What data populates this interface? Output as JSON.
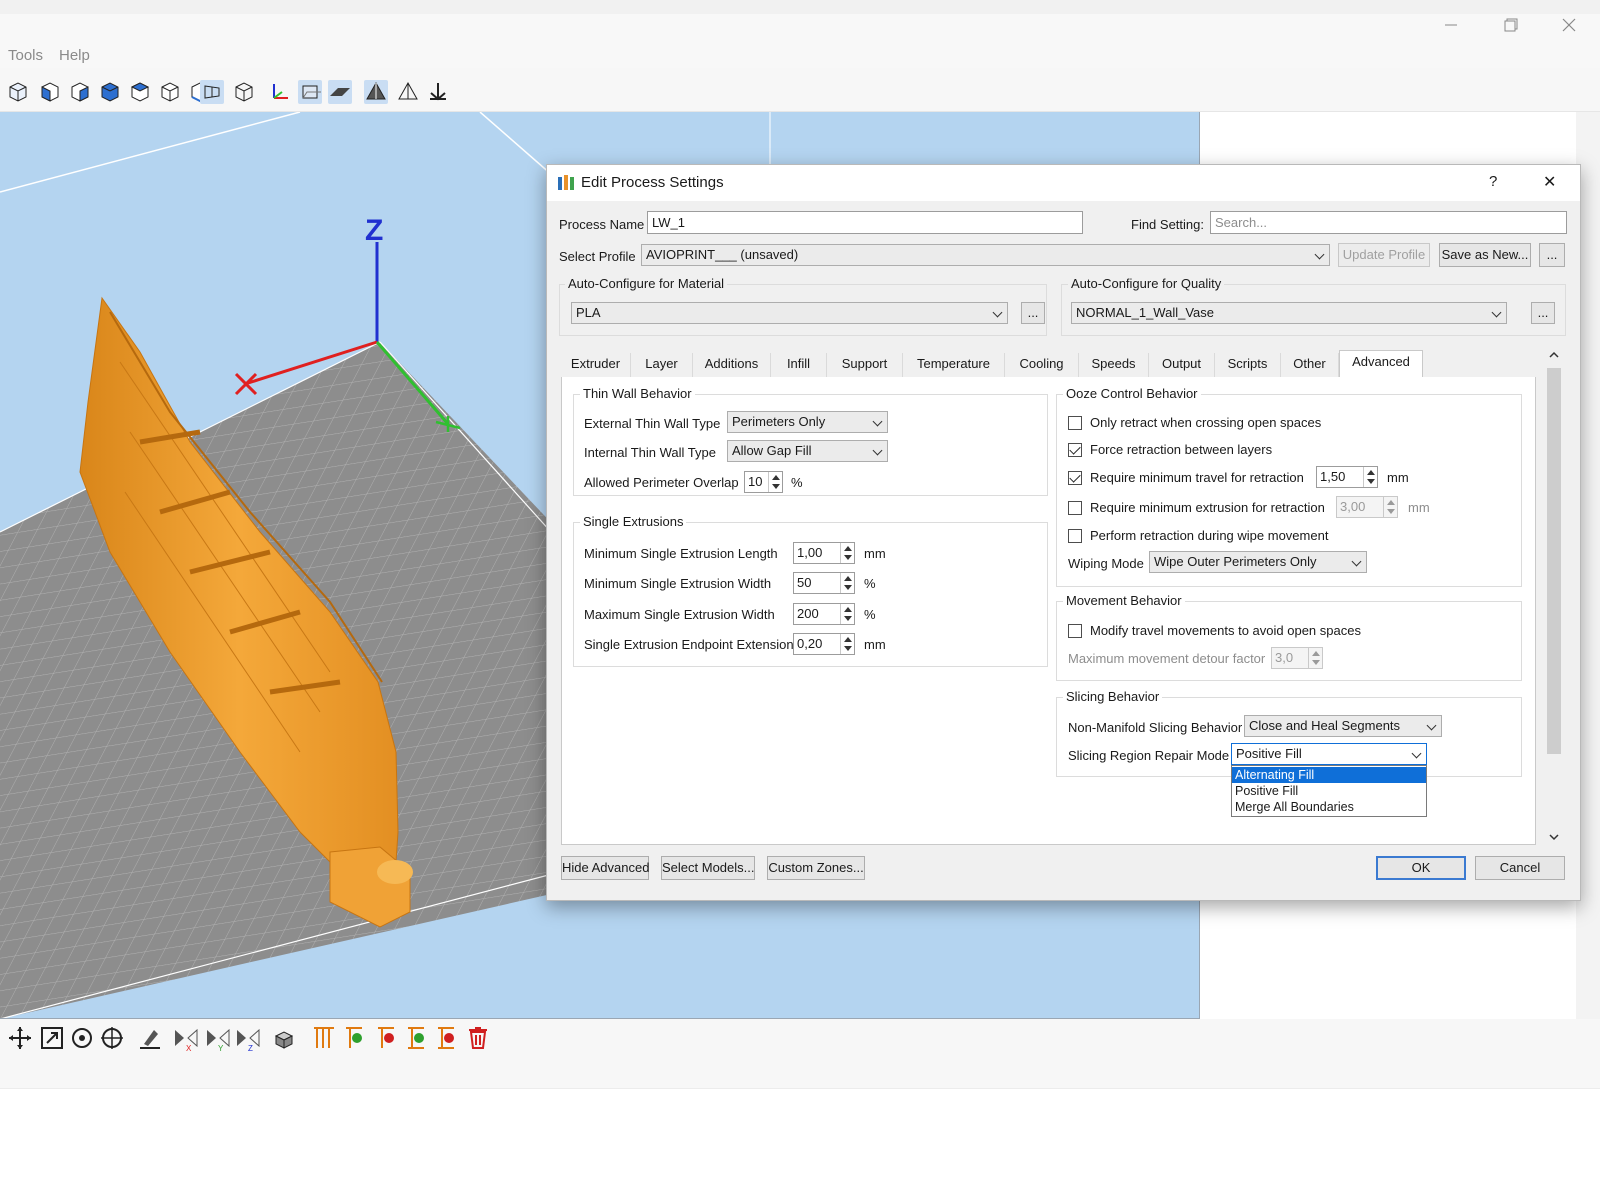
{
  "window": {
    "menu": [
      "Tools",
      "Help"
    ],
    "controls": {
      "minimize": "minimize-icon",
      "maximize": "maximize-icon",
      "close": "close-icon"
    }
  },
  "viewport": {
    "axis_z_label": "Z"
  },
  "dialog": {
    "title": "Edit Process Settings",
    "help_glyph": "?",
    "close_glyph": "✕",
    "process_name_label": "Process Name",
    "process_name_value": "LW_1",
    "find_setting_label": "Find Setting:",
    "find_setting_placeholder": "Search...",
    "select_profile_label": "Select Profile",
    "select_profile_value": "AVIOPRINT___ (unsaved)",
    "update_profile": "Update Profile",
    "save_as_new": "Save as New...",
    "more": "...",
    "material_group": "Auto-Configure for Material",
    "material_value": "PLA",
    "quality_group": "Auto-Configure for Quality",
    "quality_value": "NORMAL_1_Wall_Vase",
    "tabs": [
      "Extruder",
      "Layer",
      "Additions",
      "Infill",
      "Support",
      "Temperature",
      "Cooling",
      "Speeds",
      "Output",
      "Scripts",
      "Other",
      "Advanced"
    ],
    "active_tab": "Advanced",
    "thin_wall": {
      "title": "Thin Wall Behavior",
      "external_label": "External Thin Wall Type",
      "external_value": "Perimeters Only",
      "internal_label": "Internal Thin Wall Type",
      "internal_value": "Allow Gap Fill",
      "overlap_label": "Allowed Perimeter Overlap",
      "overlap_value": "10",
      "overlap_unit": "%"
    },
    "single_extrusions": {
      "title": "Single Extrusions",
      "min_length_label": "Minimum Single Extrusion Length",
      "min_length_value": "1,00",
      "min_length_unit": "mm",
      "min_width_label": "Minimum Single Extrusion Width",
      "min_width_value": "50",
      "min_width_unit": "%",
      "max_width_label": "Maximum Single Extrusion Width",
      "max_width_value": "200",
      "max_width_unit": "%",
      "endpoint_label": "Single Extrusion Endpoint Extension",
      "endpoint_value": "0,20",
      "endpoint_unit": "mm"
    },
    "ooze": {
      "title": "Ooze Control Behavior",
      "only_retract_label": "Only retract when crossing open spaces",
      "only_retract_checked": false,
      "force_retract_label": "Force retraction between layers",
      "force_retract_checked": true,
      "min_travel_label": "Require minimum travel for retraction",
      "min_travel_checked": true,
      "min_travel_value": "1,50",
      "min_travel_unit": "mm",
      "min_extrusion_label": "Require minimum extrusion for retraction",
      "min_extrusion_checked": false,
      "min_extrusion_value": "3,00",
      "min_extrusion_unit": "mm",
      "wipe_retract_label": "Perform retraction during wipe movement",
      "wipe_retract_checked": false,
      "wiping_mode_label": "Wiping Mode",
      "wiping_mode_value": "Wipe Outer Perimeters Only"
    },
    "movement": {
      "title": "Movement Behavior",
      "modify_label": "Modify travel movements to avoid open spaces",
      "modify_checked": false,
      "detour_label": "Maximum movement detour factor",
      "detour_value": "3,0"
    },
    "slicing": {
      "title": "Slicing Behavior",
      "non_manifold_label": "Non-Manifold Slicing Behavior",
      "non_manifold_value": "Close and Heal Segments",
      "repair_label": "Slicing Region Repair Mode",
      "repair_value": "Positive Fill",
      "repair_options": [
        "Alternating Fill",
        "Positive Fill",
        "Merge All Boundaries"
      ],
      "repair_highlighted": "Alternating Fill"
    },
    "footer": {
      "hide_advanced": "Hide Advanced",
      "select_models": "Select Models...",
      "custom_zones": "Custom Zones...",
      "ok": "OK",
      "cancel": "Cancel"
    }
  },
  "colors": {
    "model": "#f0a236",
    "bed_grid": "#9a9a9a",
    "sky": "#b4d4f0",
    "accent_blue": "#0f6fd8",
    "axis_x": "#e02020",
    "axis_y": "#30c030",
    "axis_z": "#2030d0"
  }
}
